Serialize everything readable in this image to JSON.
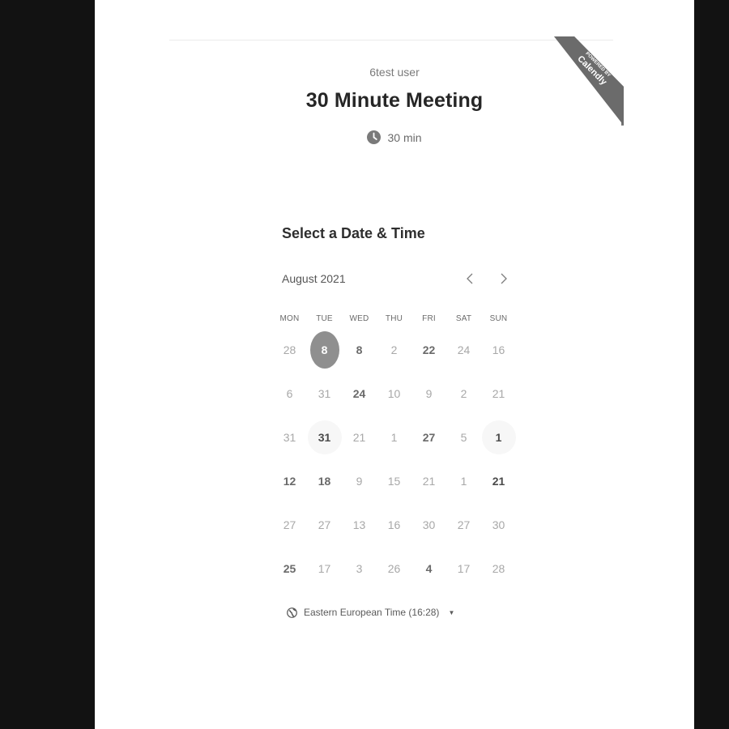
{
  "header": {
    "host": "6test user",
    "title": "30 Minute Meeting",
    "duration": "30 min"
  },
  "ribbon": {
    "line1": "POWERED BY",
    "line2": "Calendly"
  },
  "calendar": {
    "section_title": "Select a Date & Time",
    "month": "August 2021",
    "prev_icon": "chevron-left-icon",
    "next_icon": "chevron-right-icon",
    "weekdays": [
      "MON",
      "TUE",
      "WED",
      "THU",
      "FRI",
      "SAT",
      "SUN"
    ],
    "rows": [
      [
        {
          "d": "28",
          "s": "n"
        },
        {
          "d": "8",
          "s": "sel"
        },
        {
          "d": "8",
          "s": "a"
        },
        {
          "d": "2",
          "s": "n"
        },
        {
          "d": "22",
          "s": "a"
        },
        {
          "d": "24",
          "s": "n"
        },
        {
          "d": "16",
          "s": "n"
        }
      ],
      [
        {
          "d": "6",
          "s": "n"
        },
        {
          "d": "31",
          "s": "n"
        },
        {
          "d": "24",
          "s": "a"
        },
        {
          "d": "10",
          "s": "n"
        },
        {
          "d": "9",
          "s": "n"
        },
        {
          "d": "2",
          "s": "n"
        },
        {
          "d": "21",
          "s": "n"
        }
      ],
      [
        {
          "d": "31",
          "s": "n"
        },
        {
          "d": "31",
          "s": "at"
        },
        {
          "d": "21",
          "s": "n"
        },
        {
          "d": "1",
          "s": "n"
        },
        {
          "d": "27",
          "s": "a"
        },
        {
          "d": "5",
          "s": "n"
        },
        {
          "d": "1",
          "s": "at"
        }
      ],
      [
        {
          "d": "12",
          "s": "a"
        },
        {
          "d": "18",
          "s": "a"
        },
        {
          "d": "9",
          "s": "n"
        },
        {
          "d": "15",
          "s": "n"
        },
        {
          "d": "21",
          "s": "n"
        },
        {
          "d": "1",
          "s": "n"
        },
        {
          "d": "21",
          "s": "ad"
        }
      ],
      [
        {
          "d": "27",
          "s": "n"
        },
        {
          "d": "27",
          "s": "n"
        },
        {
          "d": "13",
          "s": "n"
        },
        {
          "d": "16",
          "s": "n"
        },
        {
          "d": "30",
          "s": "n"
        },
        {
          "d": "27",
          "s": "n"
        },
        {
          "d": "30",
          "s": "n"
        }
      ],
      [
        {
          "d": "25",
          "s": "a"
        },
        {
          "d": "17",
          "s": "n"
        },
        {
          "d": "3",
          "s": "n"
        },
        {
          "d": "26",
          "s": "n"
        },
        {
          "d": "4",
          "s": "a"
        },
        {
          "d": "17",
          "s": "n"
        },
        {
          "d": "28",
          "s": "n"
        }
      ]
    ]
  },
  "timezone": {
    "label": "Eastern European Time (16:28)",
    "icon": "globe-icon"
  }
}
